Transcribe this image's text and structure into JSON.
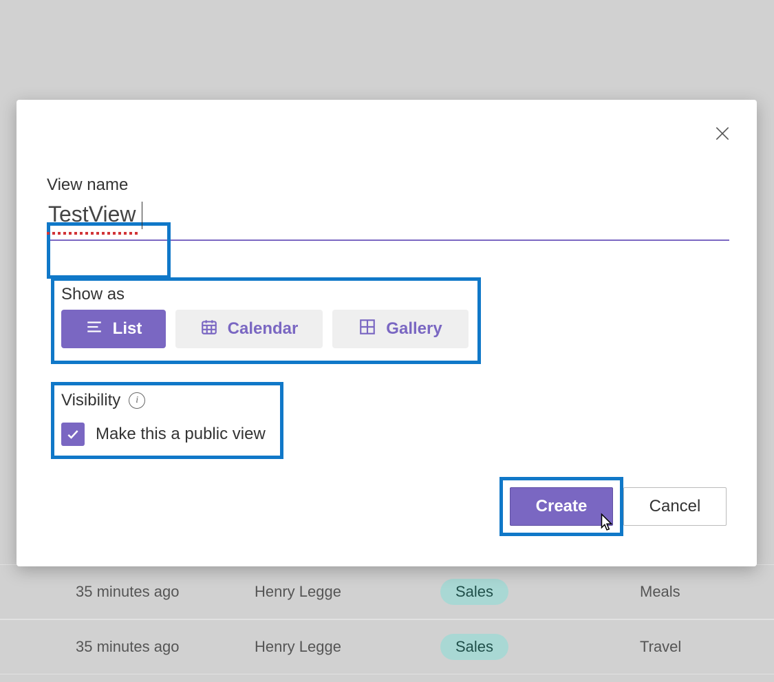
{
  "dialog": {
    "view_name_label": "View name",
    "view_name_value": "TestView",
    "show_as_label": "Show as",
    "options": {
      "list": "List",
      "calendar": "Calendar",
      "gallery": "Gallery",
      "selected": "List"
    },
    "visibility": {
      "label": "Visibility",
      "checkbox_label": "Make this a public view",
      "checked": true
    },
    "buttons": {
      "create": "Create",
      "cancel": "Cancel"
    }
  },
  "background_rows": [
    {
      "time": "35 minutes ago",
      "name": "Henry Legge",
      "dept": "Sales",
      "category": "Meals"
    },
    {
      "time": "35 minutes ago",
      "name": "Henry Legge",
      "dept": "Sales",
      "category": "Travel"
    }
  ]
}
